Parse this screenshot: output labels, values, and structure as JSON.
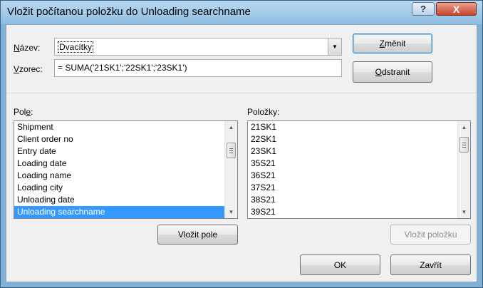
{
  "window": {
    "title": "Vložit počítanou položku do Unloading searchname",
    "help_label": "?",
    "close_label": "X"
  },
  "form": {
    "name_label_pre": "N",
    "name_label_post": "ázev:",
    "name_value": "Dvacítky",
    "formula_label_pre": "V",
    "formula_label_post": "zorec:",
    "formula_value": "= SUMA('21SK1';'22SK1';'23SK1')"
  },
  "buttons": {
    "modify_pre": "Z",
    "modify_post": "měnit",
    "delete_pre": "O",
    "delete_post": "dstranit",
    "insert_field": "Vložit pole",
    "insert_item": "Vložit položku",
    "ok": "OK",
    "close": "Zavřít"
  },
  "fields": {
    "label_pre": "Pol",
    "label_mid": "e",
    "label_post": ":",
    "items": [
      {
        "label": "Shipment"
      },
      {
        "label": "Client order no"
      },
      {
        "label": "Entry date"
      },
      {
        "label": "Loading date"
      },
      {
        "label": "Loading name"
      },
      {
        "label": "Loading city"
      },
      {
        "label": "Unloading date"
      },
      {
        "label": "Unloading searchname",
        "selected": true
      }
    ]
  },
  "items": {
    "label": "Položky:",
    "items": [
      {
        "label": "21SK1"
      },
      {
        "label": "22SK1"
      },
      {
        "label": "23SK1"
      },
      {
        "label": "35S21"
      },
      {
        "label": "36S21"
      },
      {
        "label": "37S21"
      },
      {
        "label": "38S21"
      },
      {
        "label": "39S21"
      }
    ]
  }
}
